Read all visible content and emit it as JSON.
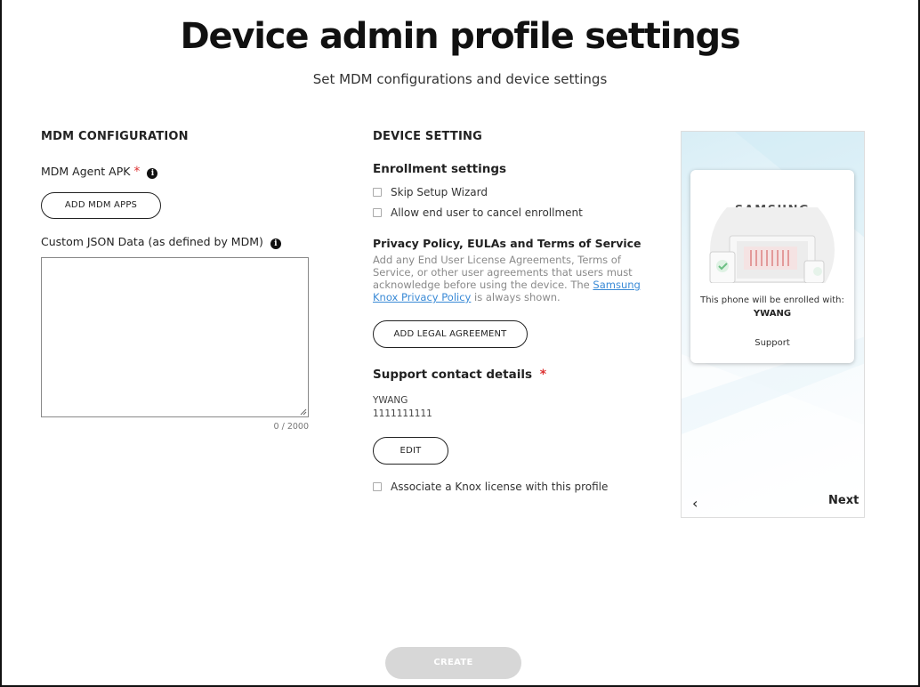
{
  "header": {
    "title": "Device admin profile settings",
    "subtitle": "Set MDM configurations and device settings"
  },
  "mdm": {
    "section_title": "MDM CONFIGURATION",
    "agent_label": "MDM Agent APK",
    "required_mark": "*",
    "add_apps_button": "ADD MDM APPS",
    "json_label": "Custom JSON Data (as defined by MDM)",
    "json_value": "",
    "char_counter": "0 / 2000"
  },
  "device": {
    "section_title": "DEVICE SETTING",
    "enrollment_title": "Enrollment settings",
    "skip_setup_label": "Skip Setup Wizard",
    "skip_setup_checked": false,
    "allow_cancel_label": "Allow end user to cancel enrollment",
    "allow_cancel_checked": false,
    "privacy_title": "Privacy Policy, EULAs and Terms of Service",
    "privacy_desc_before": "Add any End User License Agreements, Terms of Service, or other user agreements that users must acknowledge before using the device. The ",
    "privacy_link": "Samsung Knox Privacy Policy",
    "privacy_desc_after": " is always shown.",
    "add_legal_button": "ADD LEGAL AGREEMENT",
    "support_title": "Support contact details",
    "required_mark": "*",
    "support_name": "YWANG",
    "support_phone": "1111111111",
    "edit_button": "EDIT",
    "knox_license_label": "Associate a Knox license with this profile",
    "knox_license_checked": false
  },
  "preview": {
    "brand": "SAMSUNG",
    "enrolled_text": "This phone will be enrolled with:",
    "enrolled_name": "YWANG",
    "support_link": "Support",
    "next_label": "Next",
    "back_icon": "chevron-left-icon"
  },
  "footer": {
    "create_button": "CREATE"
  }
}
